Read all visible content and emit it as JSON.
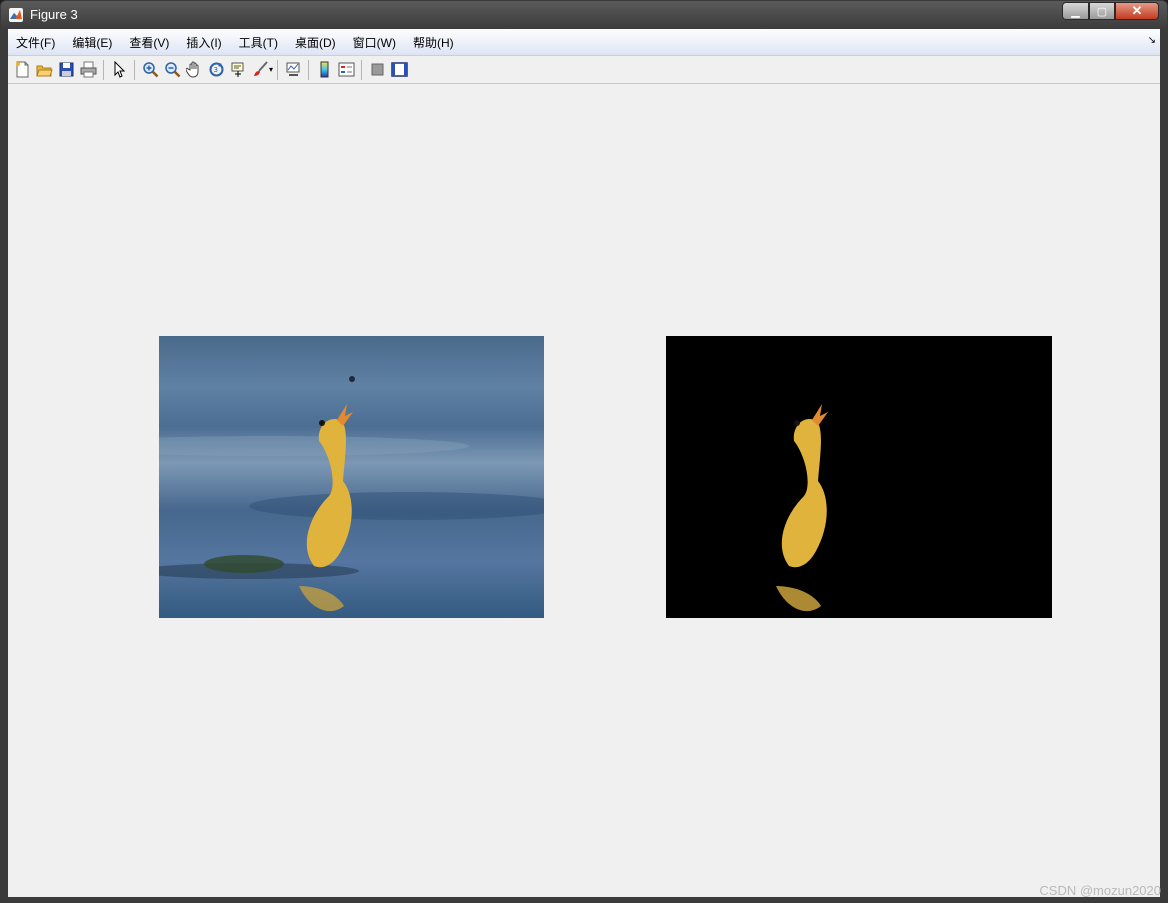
{
  "window": {
    "title": "Figure 3"
  },
  "menubar": {
    "items": [
      "文件(F)",
      "编辑(E)",
      "查看(V)",
      "插入(I)",
      "工具(T)",
      "桌面(D)",
      "窗口(W)",
      "帮助(H)"
    ]
  },
  "toolbar": {
    "icons": [
      "new-figure",
      "open-file",
      "save",
      "print",
      "edit-plot-pointer",
      "zoom-in",
      "zoom-out",
      "pan-hand",
      "rotate-3d",
      "data-cursor",
      "brush",
      "link-plot",
      "insert-colorbar",
      "insert-legend",
      "hide-plot-tools",
      "show-plot-tools"
    ]
  },
  "axes": [
    {
      "content": "original photo: duckling on water"
    },
    {
      "content": "segmented result: duckling on black background"
    }
  ],
  "watermark": "CSDN @mozun2020",
  "colors": {
    "titlebar": "#3b3b3b",
    "client": "#f0f0f0",
    "menubar": "#dde4f3",
    "close_button": "#c23b21"
  }
}
